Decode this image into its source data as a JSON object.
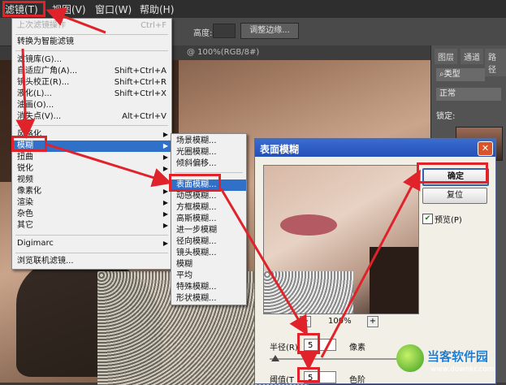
{
  "menubar": {
    "items": [
      {
        "label": "滤镜(T)"
      },
      {
        "label": "视图(V)"
      },
      {
        "label": "窗口(W)"
      },
      {
        "label": "帮助(H)"
      }
    ]
  },
  "options_bar": {
    "height_label": "高度:",
    "refine_edge_label": "调整边缘..."
  },
  "document_tab": {
    "label": "@ 100%(RGB/8#)"
  },
  "panels": {
    "tabs": [
      {
        "label": "图层"
      },
      {
        "label": "通道"
      },
      {
        "label": "路径"
      }
    ],
    "kind_label": "类型",
    "blend_mode": "正常",
    "lock_label": "锁定:"
  },
  "filter_menu": {
    "items": [
      {
        "label": "上次滤镜操作",
        "shortcut": "Ctrl+F",
        "disabled": true
      },
      {
        "label": "转换为智能滤镜",
        "shortcut": ""
      },
      {
        "label": "滤镜库(G)...",
        "shortcut": ""
      },
      {
        "label": "自适应广角(A)...",
        "shortcut": "Shift+Ctrl+A"
      },
      {
        "label": "镜头校正(R)...",
        "shortcut": "Shift+Ctrl+R"
      },
      {
        "label": "液化(L)...",
        "shortcut": "Shift+Ctrl+X"
      },
      {
        "label": "油画(O)...",
        "shortcut": ""
      },
      {
        "label": "消失点(V)...",
        "shortcut": "Alt+Ctrl+V"
      },
      {
        "label": "风格化",
        "submenu": true
      },
      {
        "label": "模糊",
        "submenu": true,
        "selected": true
      },
      {
        "label": "扭曲",
        "submenu": true
      },
      {
        "label": "锐化",
        "submenu": true
      },
      {
        "label": "视频",
        "submenu": true
      },
      {
        "label": "像素化",
        "submenu": true
      },
      {
        "label": "渲染",
        "submenu": true
      },
      {
        "label": "杂色",
        "submenu": true
      },
      {
        "label": "其它",
        "submenu": true
      },
      {
        "label": "Digimarc",
        "submenu": true
      },
      {
        "label": "浏览联机滤镜..."
      }
    ]
  },
  "blur_submenu": {
    "items": [
      {
        "label": "场景模糊..."
      },
      {
        "label": "光圈模糊..."
      },
      {
        "label": "倾斜偏移..."
      },
      {
        "label": "表面模糊...",
        "selected": true
      },
      {
        "label": "动感模糊..."
      },
      {
        "label": "方框模糊..."
      },
      {
        "label": "高斯模糊..."
      },
      {
        "label": "进一步模糊"
      },
      {
        "label": "径向模糊..."
      },
      {
        "label": "镜头模糊..."
      },
      {
        "label": "模糊"
      },
      {
        "label": "平均"
      },
      {
        "label": "特殊模糊..."
      },
      {
        "label": "形状模糊..."
      }
    ]
  },
  "dialog": {
    "title": "表面模糊",
    "ok_label": "确定",
    "reset_label": "复位",
    "preview_label": "预览(P)",
    "preview_checked": true,
    "zoom_level": "100%",
    "zoom_minus": "−",
    "zoom_plus": "+",
    "radius_label": "半径(R)",
    "radius_value": "5",
    "radius_unit": "像素",
    "threshold_label": "阈值(T",
    "threshold_value": "5",
    "threshold_unit": "色阶"
  },
  "watermark": {
    "name": "当客软件园",
    "url": "www.downkr.com"
  },
  "colors": {
    "highlight": "#3170c8",
    "annotation_red": "#e0222b",
    "title_bar": "#2d5ec4"
  }
}
